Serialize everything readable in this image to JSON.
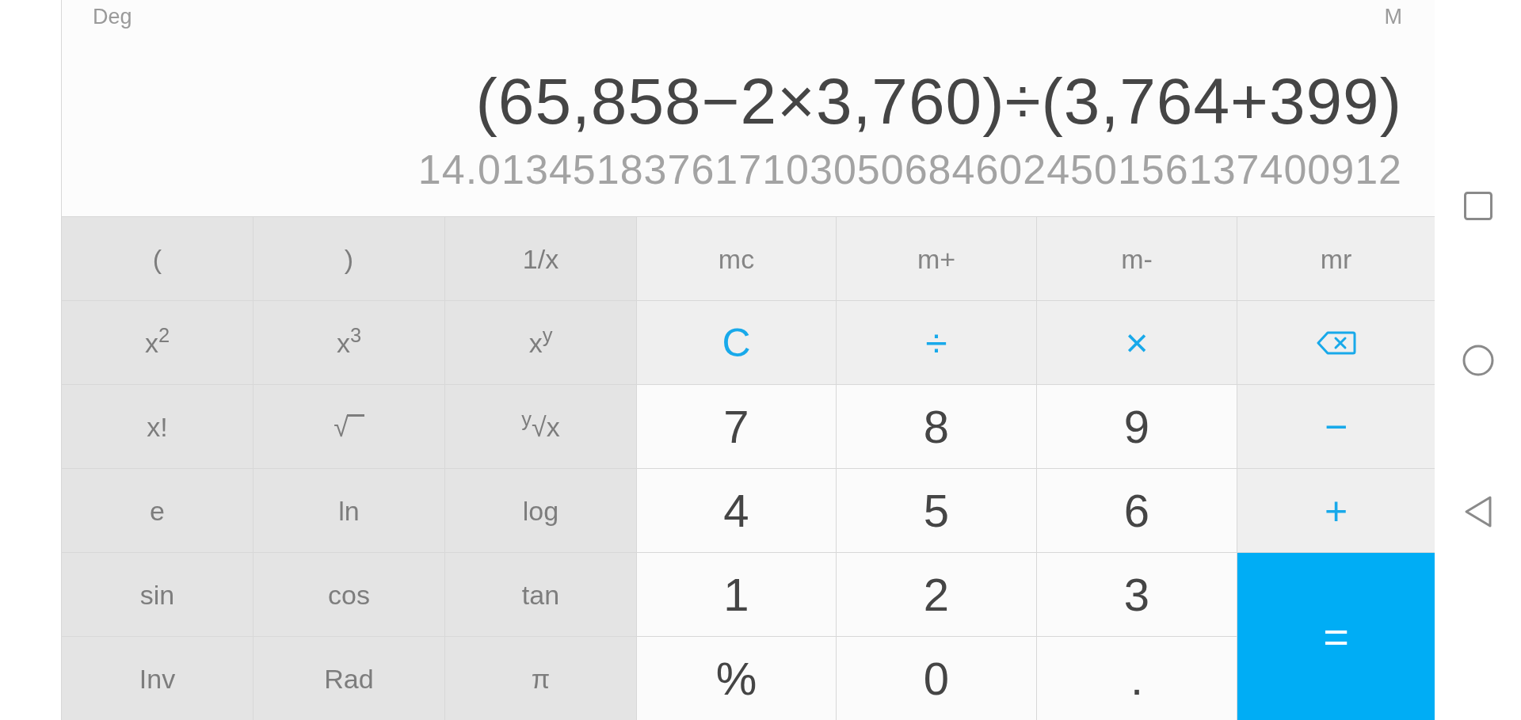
{
  "display": {
    "angle_mode": "Deg",
    "memory_indicator": "M",
    "expression": "(65,858−2×3,760)÷(3,764+399)",
    "result": "14.013451837617103050684602450156137400912"
  },
  "keypad": {
    "rows": [
      [
        {
          "kind": "function",
          "label": "("
        },
        {
          "kind": "function",
          "label": ")"
        },
        {
          "kind": "function",
          "label": "1/x"
        },
        {
          "kind": "memory",
          "label": "mc"
        },
        {
          "kind": "memory",
          "label": "m+"
        },
        {
          "kind": "memory",
          "label": "m-"
        },
        {
          "kind": "memory",
          "label": "mr"
        }
      ],
      [
        {
          "kind": "function",
          "label": "x$^{2}$"
        },
        {
          "kind": "function",
          "label": "x$^{3}$"
        },
        {
          "kind": "function",
          "label": "x$^{y}$"
        },
        {
          "kind": "operator",
          "label": "C"
        },
        {
          "kind": "operator",
          "label": "÷"
        },
        {
          "kind": "operator",
          "label": "×"
        },
        {
          "kind": "backspace"
        }
      ],
      [
        {
          "kind": "function",
          "label": "x!"
        },
        {
          "kind": "radical",
          "label": "√"
        },
        {
          "kind": "function",
          "label": "$^{y}$√x"
        },
        {
          "kind": "digit",
          "label": "7"
        },
        {
          "kind": "digit",
          "label": "8"
        },
        {
          "kind": "digit",
          "label": "9"
        },
        {
          "kind": "operator",
          "label": "−"
        }
      ],
      [
        {
          "kind": "function",
          "label": "e"
        },
        {
          "kind": "function",
          "label": "ln"
        },
        {
          "kind": "function",
          "label": "log"
        },
        {
          "kind": "digit",
          "label": "4"
        },
        {
          "kind": "digit",
          "label": "5"
        },
        {
          "kind": "digit",
          "label": "6"
        },
        {
          "kind": "operator",
          "label": "+"
        }
      ],
      [
        {
          "kind": "function",
          "label": "sin"
        },
        {
          "kind": "function",
          "label": "cos"
        },
        {
          "kind": "function",
          "label": "tan"
        },
        {
          "kind": "digit",
          "label": "1"
        },
        {
          "kind": "digit",
          "label": "2"
        },
        {
          "kind": "digit",
          "label": "3"
        },
        {
          "kind": "equals",
          "label": "="
        }
      ],
      [
        {
          "kind": "function",
          "label": "Inv"
        },
        {
          "kind": "function",
          "label": "Rad"
        },
        {
          "kind": "function",
          "label": "π"
        },
        {
          "kind": "digit",
          "label": "%"
        },
        {
          "kind": "digit",
          "label": "0"
        },
        {
          "kind": "digit",
          "label": "."
        }
      ]
    ]
  }
}
